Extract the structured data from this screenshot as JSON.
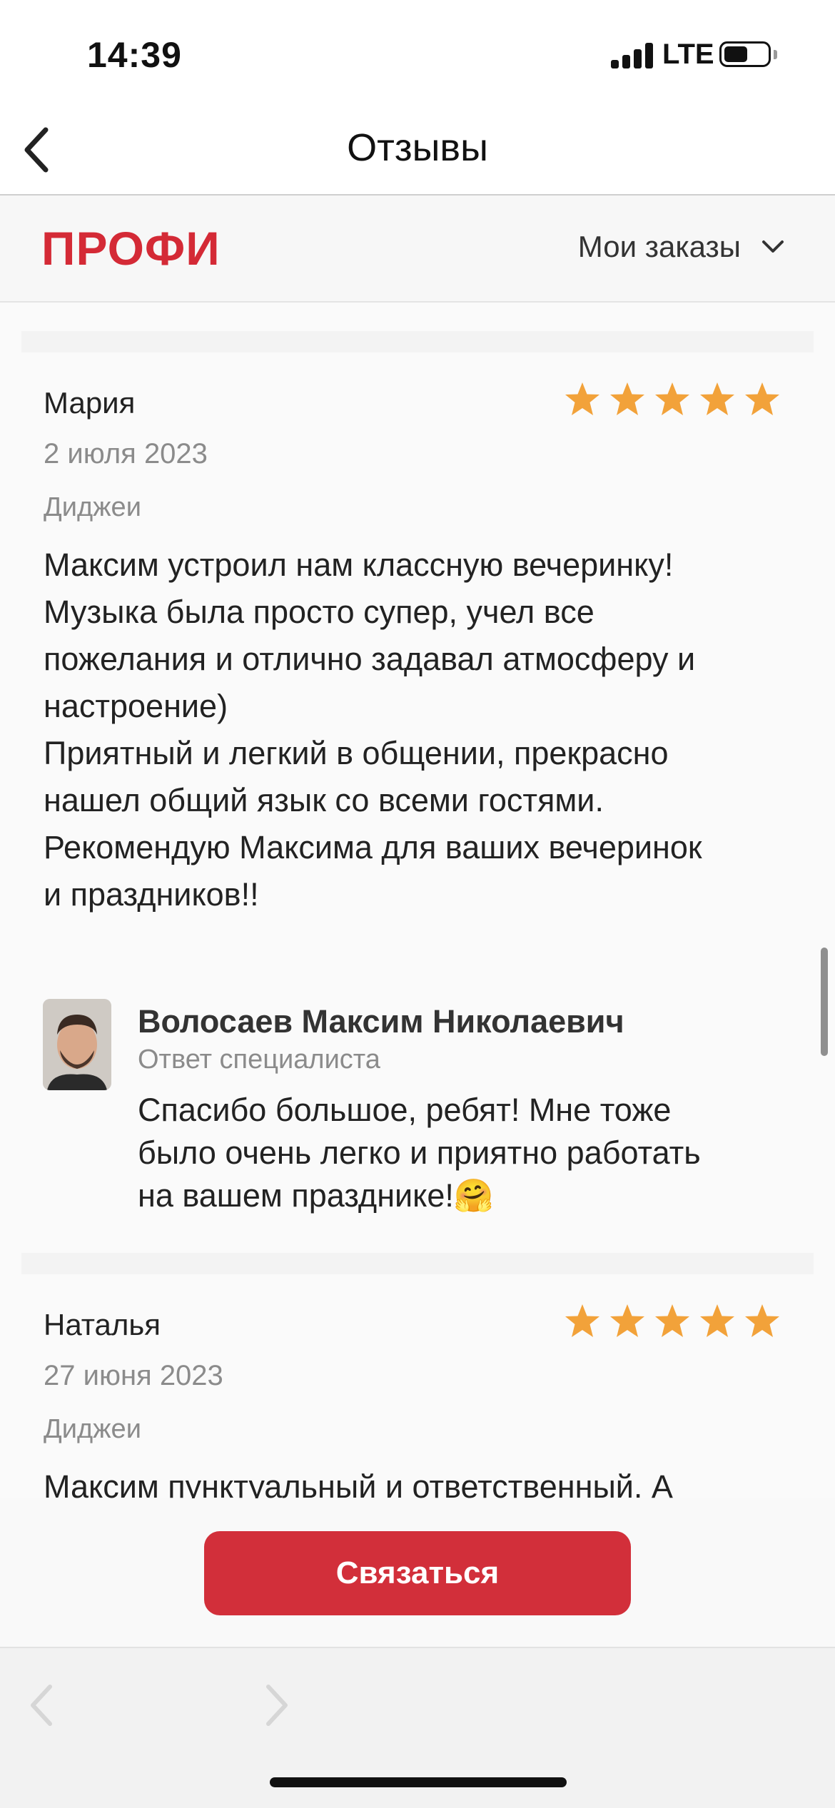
{
  "status_bar": {
    "time": "14:39",
    "network": "LTE",
    "battery_level": 0.55
  },
  "nav": {
    "title": "Отзывы",
    "back_icon": "chevron-left-icon"
  },
  "header": {
    "logo": "ПРОФИ",
    "orders_menu": "Мои заказы",
    "orders_icon": "chevron-down-icon"
  },
  "reviews": [
    {
      "author": "Мария",
      "date": "2 июля 2023",
      "category": "Диджеи",
      "rating": 5,
      "text": "Максим устроил нам классную вечеринку!\nМузыка была просто супер, учел все\nпожелания и отлично задавал атмосферу и\nнастроение)\nПриятный и легкий в общении, прекрасно\nнашел общий язык со всеми гостями.\nРекомендую Максима для ваших вечеринок\nи праздников!!",
      "reply": {
        "name": "Волосаев Максим Николаевич",
        "role": "Ответ специалиста",
        "text": "Спасибо большое, ребят! Мне тоже\nбыло очень легко и приятно работать\nна вашем празднике!🤗"
      }
    },
    {
      "author": "Наталья",
      "date": "27 июня 2023",
      "category": "Диджеи",
      "rating": 5,
      "text": "Максим пунктуальный и ответственный. А"
    }
  ],
  "actions": {
    "contact_label": "Связаться"
  },
  "browser_toolbar": {
    "back_icon": "chevron-left-icon",
    "forward_icon": "chevron-right-icon"
  },
  "colors": {
    "brand": "#d42a36",
    "star": "#f2a23a",
    "button": "#d22f3a"
  }
}
